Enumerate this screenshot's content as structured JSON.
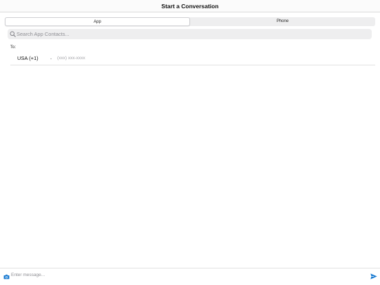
{
  "header": {
    "title": "Start a Conversation"
  },
  "segments": {
    "app": "App",
    "phone": "Phone",
    "selected": "App"
  },
  "search": {
    "placeholder": "Search App Contacts...",
    "icon": "search-icon"
  },
  "recipient": {
    "to_label": "To:",
    "country": "USA (+1)",
    "country_chevron": "⌄",
    "phone_placeholder": "(xxx) xxx-xxxx"
  },
  "composer": {
    "placeholder": "Enter message...",
    "camera_icon": "camera-icon",
    "send_icon": "send-icon"
  },
  "colors": {
    "accent": "#1a7bd1",
    "segment_bg": "#eeeeef",
    "divider": "#e2e2e2"
  }
}
